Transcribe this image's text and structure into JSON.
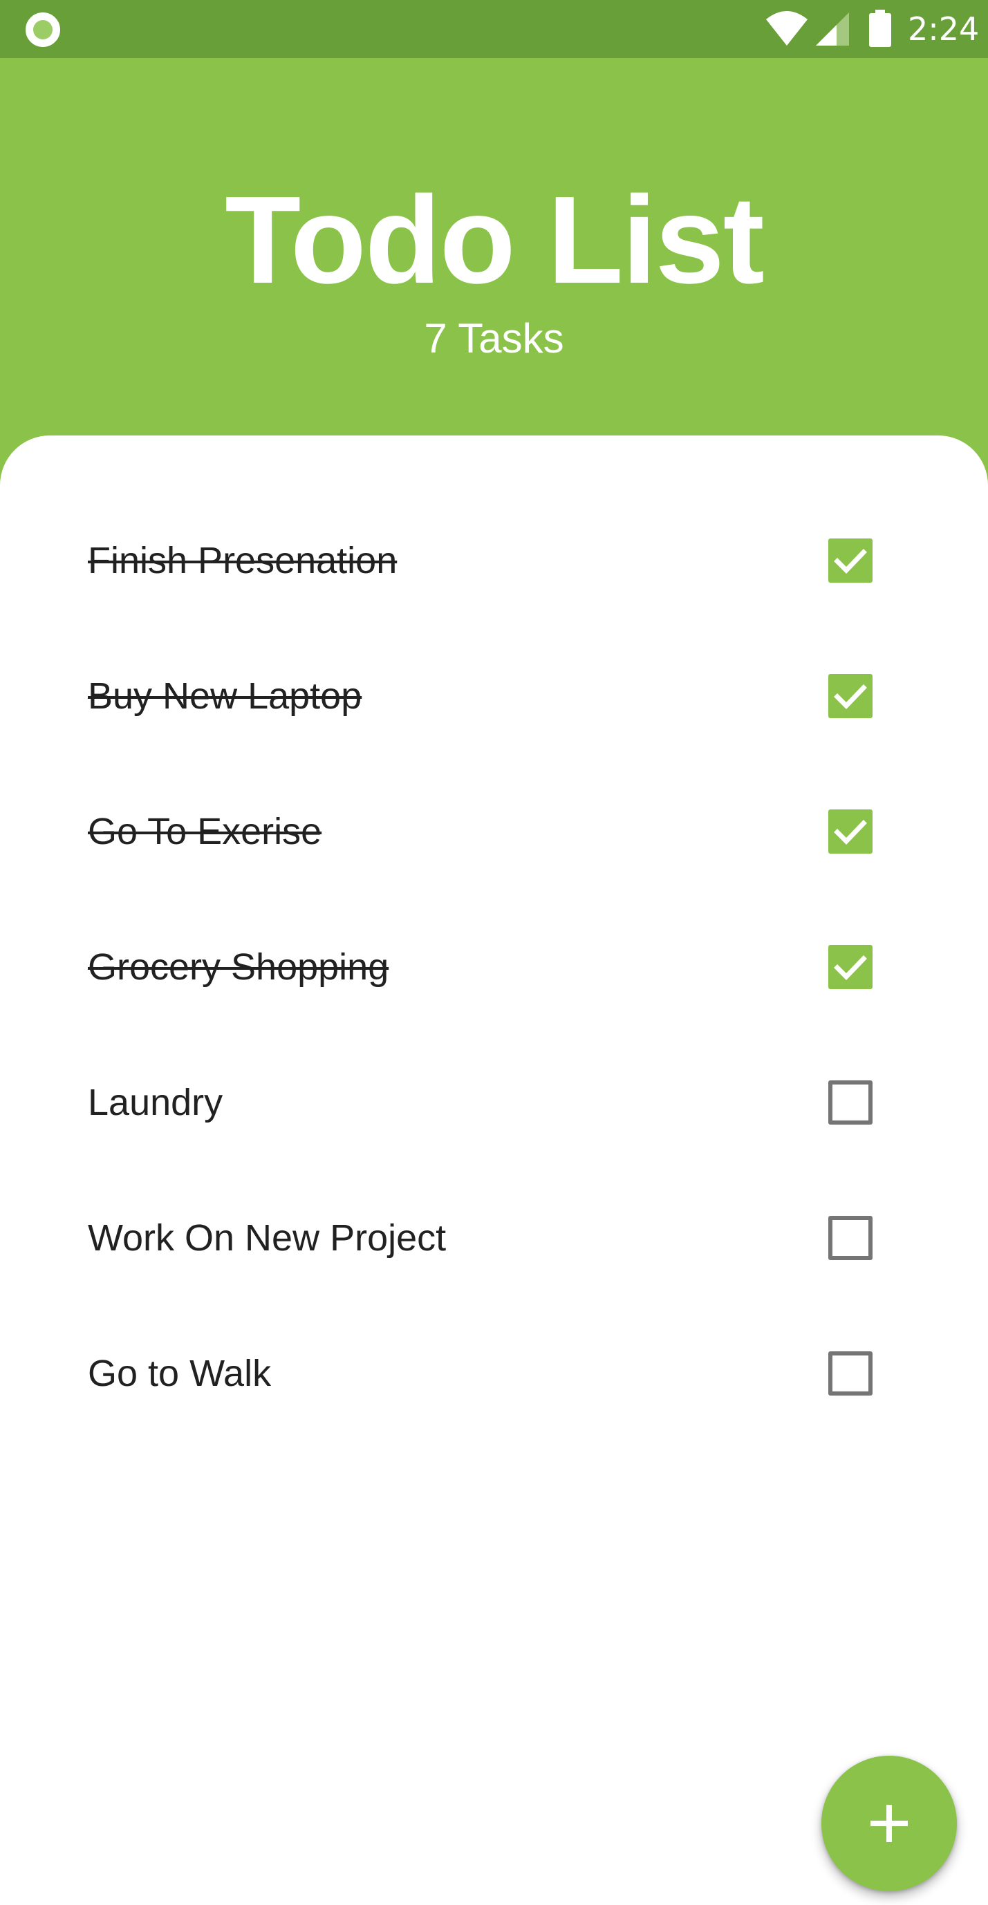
{
  "status_bar": {
    "time": "2:24",
    "icons": [
      "record-indicator-icon",
      "wifi-icon",
      "cell-signal-icon",
      "battery-icon"
    ]
  },
  "header": {
    "title": "Todo List",
    "subtitle": "7 Tasks"
  },
  "tasks": [
    {
      "label": "Finish Presenation",
      "done": true
    },
    {
      "label": "Buy New Laptop",
      "done": true
    },
    {
      "label": "Go To Exerise",
      "done": true
    },
    {
      "label": "Grocery Shopping",
      "done": true
    },
    {
      "label": "Laundry",
      "done": false
    },
    {
      "label": "Work On New Project",
      "done": false
    },
    {
      "label": "Go to Walk",
      "done": false
    }
  ],
  "fab": {
    "icon": "plus-icon"
  },
  "colors": {
    "primary": "#8BC34A",
    "primary_dark": "#689F38",
    "text": "#212121",
    "unchecked_border": "#757575"
  }
}
